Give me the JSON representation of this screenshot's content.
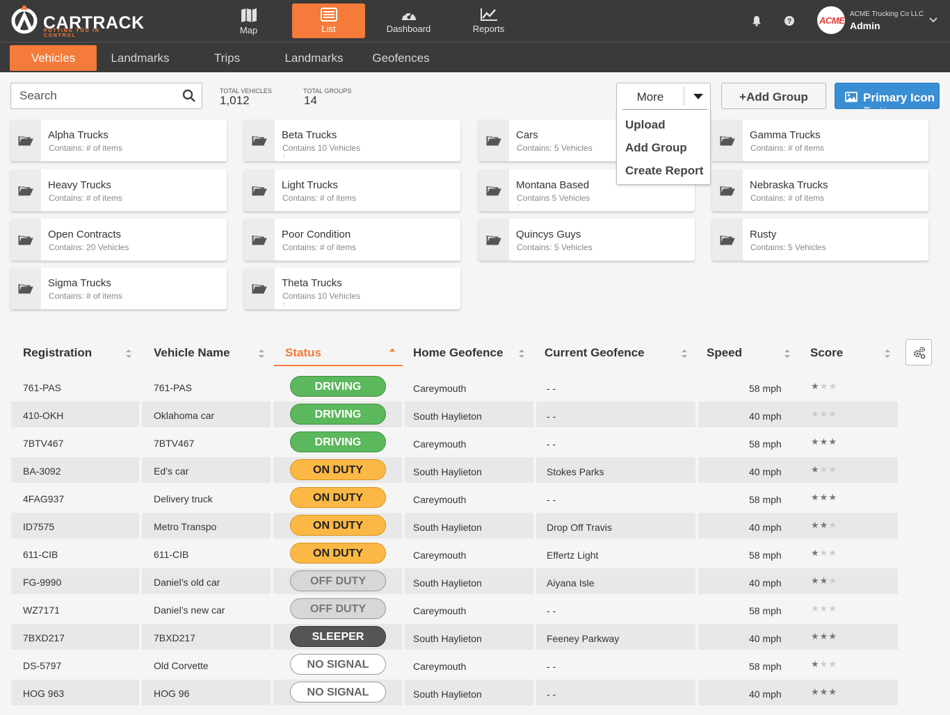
{
  "app": {
    "logo_text": "CARTRACK",
    "tagline": "PUTTING YOU IN CONTROL",
    "company": "ACME Trucking Co LLC",
    "user": "Admin",
    "company_logo": "ACME",
    "accent": "#f47b3a"
  },
  "nav": [
    {
      "label": "Map",
      "icon": "map-icon",
      "active": false
    },
    {
      "label": "List",
      "icon": "list-icon",
      "active": true
    },
    {
      "label": "Dashboard",
      "icon": "dashboard-icon",
      "active": false
    },
    {
      "label": "Reports",
      "icon": "chart-icon",
      "active": false
    }
  ],
  "subnav": [
    {
      "label": "Vehicles",
      "active": true
    },
    {
      "label": "Landmarks",
      "active": false
    },
    {
      "label": "Trips",
      "active": false
    },
    {
      "label": "Landmarks",
      "active": false
    },
    {
      "label": "Geofences",
      "active": false
    }
  ],
  "toolbar": {
    "search_placeholder": "Search",
    "total_vehicles_label": "TOTAL VEHICLES",
    "total_vehicles": "1,012",
    "total_groups_label": "TOTAL GROUPS",
    "total_groups": "14",
    "more_label": "More",
    "more_menu": [
      "Upload",
      "Add Group",
      "Create Report"
    ],
    "add_group_label": "Add Group",
    "primary_label": "Primary Icon Button"
  },
  "groups": [
    {
      "name": "Alpha Trucks",
      "count": "Contains: # of items",
      "dot": ""
    },
    {
      "name": "Beta Trucks",
      "count": "Contains  10 Vehicles",
      "dot": ":"
    },
    {
      "name": "Cars",
      "count": "Contains: 5 Vehicles",
      "dot": ""
    },
    {
      "name": "Gamma Trucks",
      "count": "Contains: # of items",
      "dot": ""
    },
    {
      "name": "Heavy Trucks",
      "count": "Contains: # of items",
      "dot": ""
    },
    {
      "name": "Light Trucks",
      "count": "Contains: # of items",
      "dot": ""
    },
    {
      "name": "Montana Based",
      "count": "Contains  5 Vehicles",
      "dot": ":"
    },
    {
      "name": "Nebraska Trucks",
      "count": "Contains: # of items",
      "dot": ""
    },
    {
      "name": "Open Contracts",
      "count": "Contains: 20 Vehicles",
      "dot": ""
    },
    {
      "name": "Poor Condition",
      "count": "Contains: # of items",
      "dot": ""
    },
    {
      "name": "Quincys Guys",
      "count": "Contains: 5 Vehicles",
      "dot": ""
    },
    {
      "name": "Rusty",
      "count": "Contains: 5 Vehicles",
      "dot": ""
    },
    {
      "name": "Sigma Trucks",
      "count": "Contains: # of items",
      "dot": ""
    },
    {
      "name": "Theta Trucks",
      "count": "Contains  10 Vehicles",
      "dot": ":"
    }
  ],
  "table": {
    "columns": [
      "Registration",
      "Vehicle Name",
      "Status",
      "Home Geofence",
      "Current Geofence",
      "Speed",
      "Score"
    ],
    "sorted_column": "Status",
    "rows": [
      {
        "reg": "761-PAS",
        "name": "761-PAS",
        "status": "DRIVING",
        "kind": "driving",
        "home": "Careymouth",
        "current": "- -",
        "speed": "58 mph",
        "score": 1
      },
      {
        "reg": "410-OKH",
        "name": "Oklahoma car",
        "status": "DRIVING",
        "kind": "driving",
        "home": "South Haylieton",
        "current": "- -",
        "speed": "40 mph",
        "score": 0
      },
      {
        "reg": "7BTV467",
        "name": "7BTV467",
        "status": "DRIVING",
        "kind": "driving",
        "home": "Careymouth",
        "current": "- -",
        "speed": "58 mph",
        "score": 3
      },
      {
        "reg": "BA-3092",
        "name": "Ed’s car",
        "status": "ON DUTY",
        "kind": "onduty",
        "home": "South Haylieton",
        "current": "Stokes Parks",
        "speed": "40 mph",
        "score": 1
      },
      {
        "reg": "4FAG937",
        "name": "Delivery truck",
        "status": "ON DUTY",
        "kind": "onduty",
        "home": "Careymouth",
        "current": "- -",
        "speed": "58 mph",
        "score": 3
      },
      {
        "reg": "ID7575",
        "name": "Metro Transpo",
        "status": "ON DUTY",
        "kind": "onduty",
        "home": "South Haylieton",
        "current": "Drop Off Travis",
        "speed": "40 mph",
        "score": 2
      },
      {
        "reg": "611-CIB",
        "name": "611-CIB",
        "status": "ON DUTY",
        "kind": "onduty",
        "home": "Careymouth",
        "current": "Effertz Light",
        "speed": "58 mph",
        "score": 1
      },
      {
        "reg": "FG-9990",
        "name": "Daniel’s old car",
        "status": "OFF DUTY",
        "kind": "offduty",
        "home": "South Haylieton",
        "current": "Aiyana Isle",
        "speed": "40 mph",
        "score": 2
      },
      {
        "reg": "WZ7171",
        "name": "Daniel’s new car",
        "status": "OFF DUTY",
        "kind": "offduty",
        "home": "Careymouth",
        "current": "- -",
        "speed": "58 mph",
        "score": 0
      },
      {
        "reg": "7BXD217",
        "name": "7BXD217",
        "status": "SLEEPER",
        "kind": "sleeper",
        "home": "South Haylieton",
        "current": "Feeney Parkway",
        "speed": "40 mph",
        "score": 3
      },
      {
        "reg": "DS-5797",
        "name": "Old Corvette",
        "status": "NO SIGNAL",
        "kind": "nosignal",
        "home": "Careymouth",
        "current": "- -",
        "speed": "58 mph",
        "score": 1
      },
      {
        "reg": "HOG 963",
        "name": "HOG 96",
        "status": "NO SIGNAL",
        "kind": "nosignal",
        "home": "South Haylieton",
        "current": "- -",
        "speed": "40 mph",
        "score": 3
      }
    ]
  }
}
